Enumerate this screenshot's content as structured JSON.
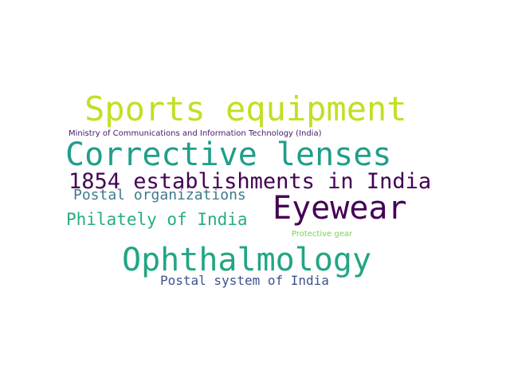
{
  "wordcloud": {
    "words": {
      "sports_equipment": {
        "text": "Sports equipment",
        "color": "#c2df23"
      },
      "ministry": {
        "text": "Ministry of Communications and Information Technology (India)",
        "color": "#48186a"
      },
      "corrective_lenses": {
        "text": "Corrective lenses",
        "color": "#1f9e89"
      },
      "establishments_1854": {
        "text": "1854 establishments in India",
        "color": "#440154"
      },
      "postal_organizations": {
        "text": "Postal organizations",
        "color": "#3e7a8c"
      },
      "eyewear": {
        "text": "Eyewear",
        "color": "#440154"
      },
      "philately": {
        "text": "Philately of India",
        "color": "#27ad81"
      },
      "protective_gear": {
        "text": "Protective gear",
        "color": "#7ad151"
      },
      "ophthalmology": {
        "text": "Ophthalmology",
        "color": "#21a585"
      },
      "postal_system": {
        "text": "Postal system of India",
        "color": "#3b528b"
      }
    }
  }
}
